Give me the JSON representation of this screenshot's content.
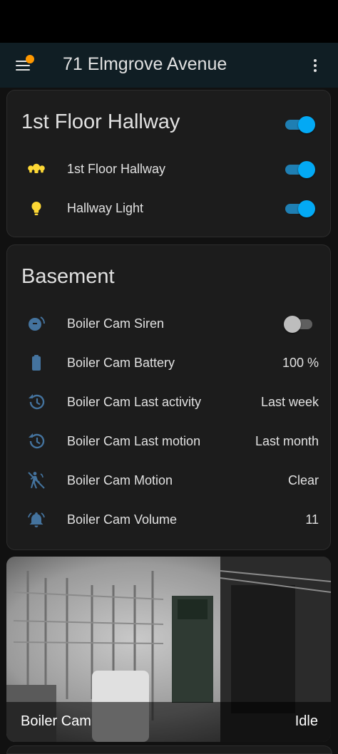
{
  "header": {
    "title": "71 Elmgrove Avenue",
    "menu_icon": "menu-icon",
    "notification_badge_color": "#ff9800",
    "overflow_icon": "dots-vertical-icon"
  },
  "colors": {
    "accent": "#03a9f4",
    "icon_light": "#fdd835",
    "icon_device": "#44739e",
    "card_bg": "#1c1c1c",
    "page_bg": "#111111"
  },
  "cards": {
    "hallway": {
      "title": "1st Floor Hallway",
      "header_toggle": true,
      "rows": [
        {
          "label": "1st Floor Hallway",
          "icon": "lightbulb-group-icon",
          "on": true
        },
        {
          "label": "Hallway Light",
          "icon": "lightbulb-icon",
          "on": true
        }
      ]
    },
    "basement": {
      "title": "Basement",
      "rows": [
        {
          "label": "Boiler Cam Siren",
          "icon": "alarm-bell-icon",
          "on": false
        },
        {
          "label": "Boiler Cam Battery",
          "icon": "battery-icon",
          "state": "100 %"
        },
        {
          "label": "Boiler Cam Last activity",
          "icon": "history-icon",
          "state": "Last week"
        },
        {
          "label": "Boiler Cam Last motion",
          "icon": "history-icon",
          "state": "Last month"
        },
        {
          "label": "Boiler Cam Motion",
          "icon": "motion-sensor-off-icon",
          "state": "Clear"
        },
        {
          "label": "Boiler Cam Volume",
          "icon": "bell-ring-icon",
          "state": "11"
        }
      ]
    },
    "camera": {
      "name": "Boiler Cam",
      "state": "Idle"
    }
  }
}
